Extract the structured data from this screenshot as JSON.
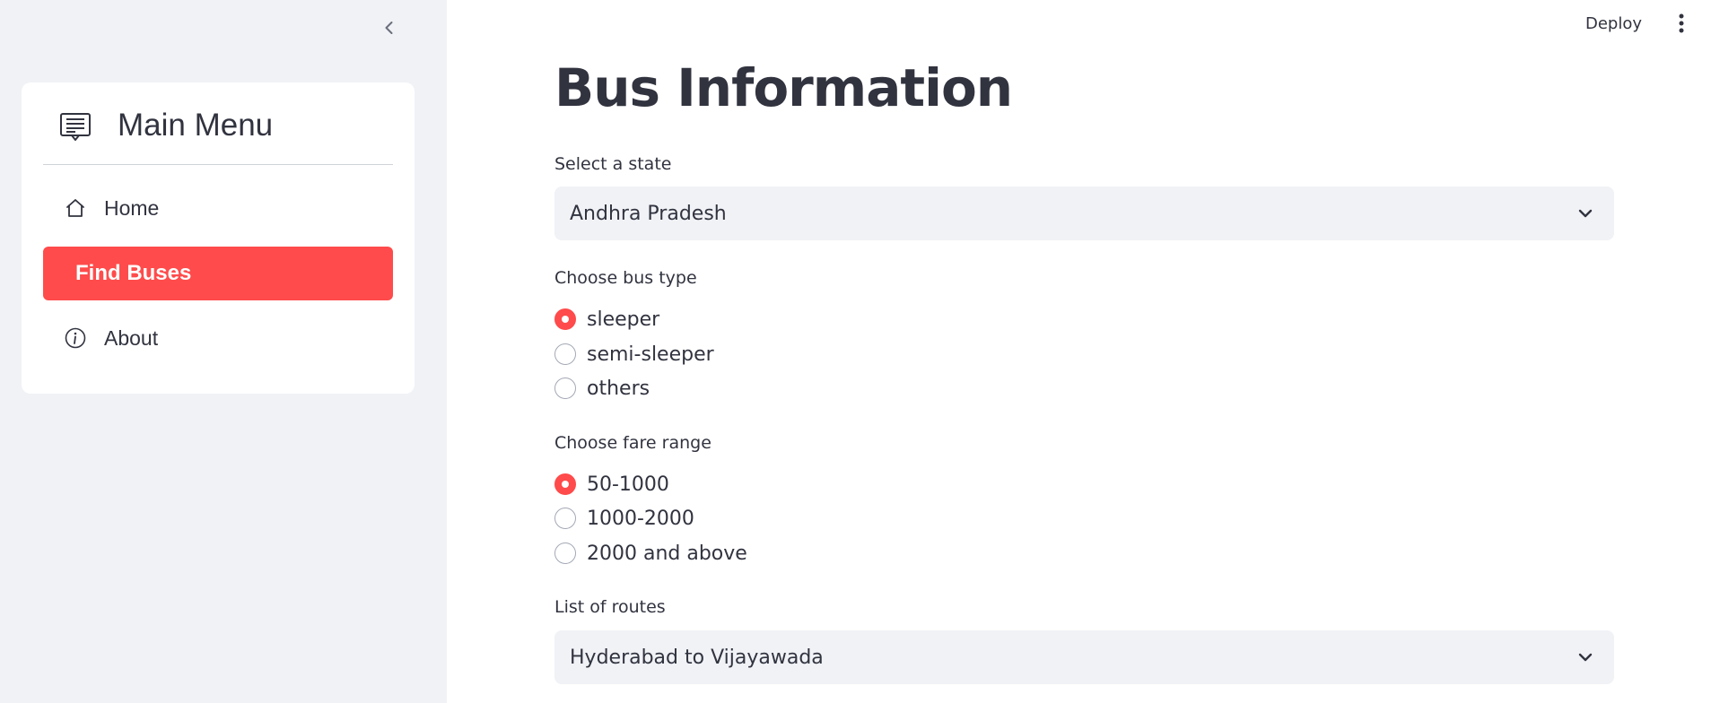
{
  "header": {
    "deploy_label": "Deploy",
    "menu_icon": "kebab-menu-icon"
  },
  "sidebar": {
    "collapse_icon": "chevron-left-icon",
    "menu_title": "Main Menu",
    "menu_icon": "menu-list-icon",
    "items": [
      {
        "label": "Home",
        "icon": "home-icon",
        "active": false
      },
      {
        "label": "Find Buses",
        "icon": "",
        "active": true
      },
      {
        "label": "About",
        "icon": "info-icon",
        "active": false
      }
    ],
    "accent_color": "#ff4b4b"
  },
  "main": {
    "title": "Bus Information",
    "state": {
      "label": "Select a state",
      "value": "Andhra Pradesh"
    },
    "bus_type": {
      "label": "Choose bus type",
      "options": [
        "sleeper",
        "semi-sleeper",
        "others"
      ],
      "selected": "sleeper"
    },
    "fare": {
      "label": "Choose fare range",
      "options": [
        "50-1000",
        "1000-2000",
        "2000 and above"
      ],
      "selected": "50-1000"
    },
    "routes": {
      "label": "List of routes",
      "value": "Hyderabad to Vijayawada"
    }
  }
}
